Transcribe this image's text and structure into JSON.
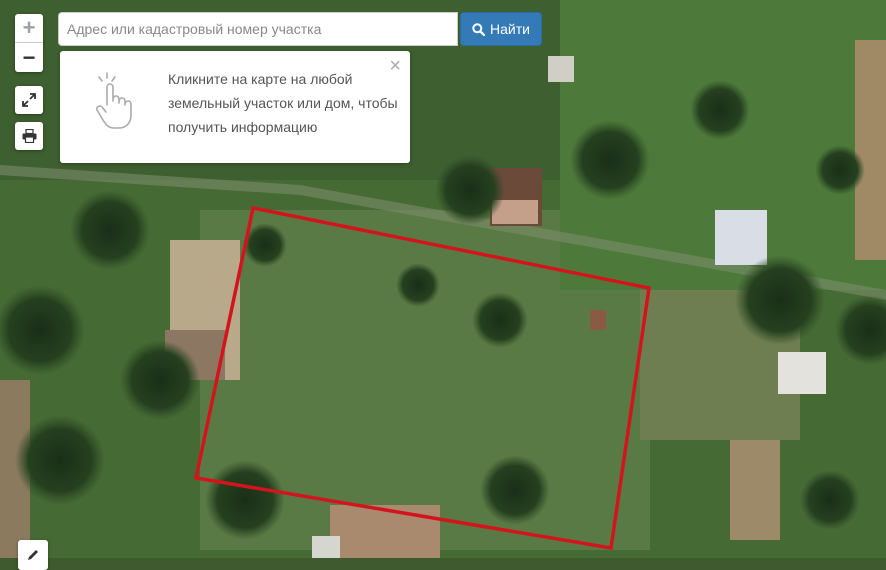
{
  "search": {
    "placeholder": "Адрес или кадастровый номер участка",
    "button_label": "Найти"
  },
  "info_panel": {
    "message": "Кликните на карте на любой земельный участок или дом, чтобы получить информацию",
    "close_symbol": "×"
  },
  "controls": {
    "zoom_in": "+",
    "zoom_out": "−",
    "fullscreen_icon": "fullscreen-icon",
    "print_icon": "print-icon",
    "edit_icon": "pencil-icon"
  },
  "colors": {
    "parcel_outline": "#d4141c",
    "search_button": "#337ab7"
  }
}
